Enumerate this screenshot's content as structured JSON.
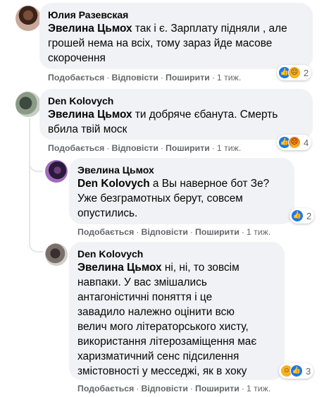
{
  "comments": [
    {
      "author": "Юлия Разевская",
      "mention": "Эвелина Цьмох",
      "lines": [
        " так і є. Зарплату підняли , але",
        "грошей нема на всіх, тому зараз йде масове",
        "скорочення"
      ],
      "actions": {
        "like": "Подобається",
        "reply": "Відповісти",
        "share": "Поширити",
        "sep": "·",
        "time": "1 тиж."
      },
      "reactions": {
        "icons": [
          "like-icon",
          "sad-icon"
        ],
        "count": "2"
      }
    },
    {
      "author": "Den Kolovych",
      "mention": "Эвелина Цьмох",
      "lines": [
        " ти добряче єбанута. Смерть",
        "вбила твій моск"
      ],
      "actions": {
        "like": "Подобається",
        "reply": "Відповісти",
        "share": "Поширити",
        "sep": "·",
        "time": "1 тиж."
      },
      "reactions": {
        "icons": [
          "like-icon",
          "angry-icon"
        ],
        "count": "4"
      }
    },
    {
      "author": "Эвелина Цьмох",
      "mention": "Den Kolovych",
      "lines": [
        " а Вы наверное бот Зе?",
        "Уже безграмотных берут, совсем",
        "опустились."
      ],
      "actions": {
        "like": "Подобається",
        "reply": "Відповісти",
        "share": "Поширити",
        "sep": "·",
        "time": "1 тиж."
      },
      "reactions": {
        "icons": [
          "like-icon"
        ],
        "count": "2"
      }
    },
    {
      "author": "Den Kolovych",
      "mention": "Эвелина Цьмох",
      "lines": [
        " ні, ні, то зовсім",
        "навпаки. У вас змішались",
        "антагоністичні поняття і це",
        "завадило належно оцінити всю",
        "велич мого літераторського хисту,",
        "використання літерозаміщення має",
        "харизматичний сенс підсилення",
        "змістовності у месседжі, як в хоку"
      ],
      "actions": {
        "like": "Подобається",
        "reply": "Відповісти",
        "share": "Поширити",
        "sep": "·",
        "time": "1 тиж."
      },
      "reactions": {
        "icons": [
          "haha-icon",
          "like-icon"
        ],
        "count": "3"
      }
    }
  ]
}
